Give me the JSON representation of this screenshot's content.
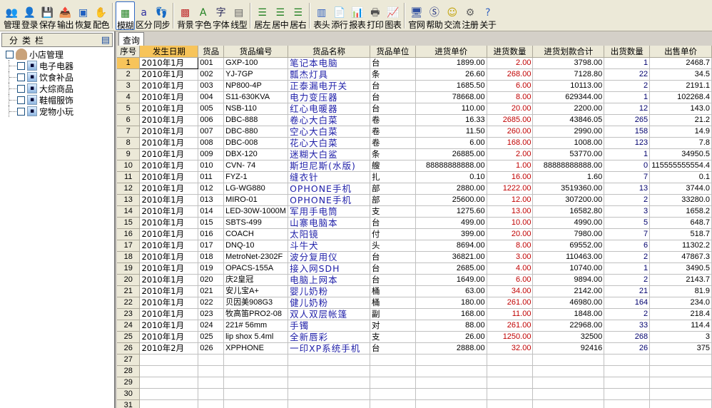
{
  "toolbar": {
    "groups": [
      [
        {
          "name": "manage",
          "label": "管理",
          "icon": "people-icon",
          "glyph": "👥",
          "color": "#c04040"
        },
        {
          "name": "login",
          "label": "登录",
          "icon": "user-icon",
          "glyph": "👤",
          "color": "#3050b0"
        },
        {
          "name": "save",
          "label": "保存",
          "icon": "disk-icon",
          "glyph": "💾",
          "color": "#6060a0"
        },
        {
          "name": "export",
          "label": "输出",
          "icon": "export-icon",
          "glyph": "📤",
          "color": "#c03030"
        },
        {
          "name": "restore",
          "label": "恢复",
          "icon": "cube-icon",
          "glyph": "▣",
          "color": "#2060c0"
        },
        {
          "name": "colors",
          "label": "配色",
          "icon": "hand-icon",
          "glyph": "✋",
          "color": "#c04040"
        }
      ],
      [
        {
          "name": "fuzzy",
          "label": "模糊",
          "icon": "grid-fuzzy-icon",
          "glyph": "▦",
          "color": "#208020",
          "active": true
        },
        {
          "name": "distinguish",
          "label": "区分",
          "icon": "text-a-icon",
          "glyph": "a",
          "color": "#3030a0"
        },
        {
          "name": "sync",
          "label": "同步",
          "icon": "footprint-icon",
          "glyph": "👣",
          "color": "#a0a0a0"
        }
      ],
      [
        {
          "name": "background",
          "label": "背景",
          "icon": "palette-grid-icon",
          "glyph": "▩",
          "color": "#c03030"
        },
        {
          "name": "font-color",
          "label": "字色",
          "icon": "font-color-icon",
          "glyph": "A",
          "color": "#208020"
        },
        {
          "name": "font",
          "label": "字体",
          "icon": "font-icon",
          "glyph": "字",
          "color": "#303060"
        },
        {
          "name": "gridlines",
          "label": "线型",
          "icon": "gridline-icon",
          "glyph": "▤",
          "color": "#606060"
        }
      ],
      [
        {
          "name": "align-left",
          "label": "居左",
          "icon": "align-left-icon",
          "glyph": "☰",
          "color": "#208020"
        },
        {
          "name": "align-center",
          "label": "居中",
          "icon": "align-center-icon",
          "glyph": "☰",
          "color": "#208020"
        },
        {
          "name": "align-right",
          "label": "居右",
          "icon": "align-right-icon",
          "glyph": "☰",
          "color": "#208020"
        }
      ],
      [
        {
          "name": "header",
          "label": "表头",
          "icon": "table-header-icon",
          "glyph": "▥",
          "color": "#3060c0"
        },
        {
          "name": "add-row",
          "label": "添行",
          "icon": "add-row-icon",
          "glyph": "📄",
          "color": "#3060c0"
        },
        {
          "name": "report",
          "label": "报表",
          "icon": "report-icon",
          "glyph": "📊",
          "color": "#3050a0"
        },
        {
          "name": "print",
          "label": "打印",
          "icon": "printer-icon",
          "glyph": "🖶",
          "color": "#505050"
        },
        {
          "name": "chart",
          "label": "图表",
          "icon": "chart-icon",
          "glyph": "📈",
          "color": "#c03030"
        }
      ],
      [
        {
          "name": "website",
          "label": "官网",
          "icon": "monitor-icon",
          "glyph": "🖥",
          "color": "#3050a0"
        },
        {
          "name": "help",
          "label": "帮助",
          "icon": "help-s-icon",
          "glyph": "Ⓢ",
          "color": "#203080"
        },
        {
          "name": "chat",
          "label": "交流",
          "icon": "smiley-icon",
          "glyph": "☺",
          "color": "#c0a000"
        },
        {
          "name": "register",
          "label": "注册",
          "icon": "register-icon",
          "glyph": "⚙",
          "color": "#606060"
        },
        {
          "name": "about",
          "label": "关于",
          "icon": "question-icon",
          "glyph": "?",
          "color": "#3060c0"
        }
      ]
    ]
  },
  "sidebar": {
    "title": "分类栏",
    "root": "小店管理",
    "items": [
      "电子电器",
      "饮食补品",
      "大综商品",
      "鞋帽服饰",
      "宠物小玩"
    ]
  },
  "grid": {
    "tab": "查询",
    "columns": [
      "序号",
      "发生日期",
      "货品",
      "货品编号",
      "货品名称",
      "货品单位",
      "进货单价",
      "进货数量",
      "进货划款合计",
      "出货数量",
      "出售单价"
    ],
    "rows": [
      [
        "1",
        "2010年1月",
        "001",
        "GXP-100",
        "笔记本电脑",
        "台",
        "1899.00",
        "2.00",
        "3798.00",
        "1",
        "2468.7"
      ],
      [
        "2",
        "2010年1月",
        "002",
        "YJ-7GP",
        "瓢杰灯具",
        "条",
        "26.60",
        "268.00",
        "7128.80",
        "22",
        "34.5"
      ],
      [
        "3",
        "2010年1月",
        "003",
        "NP800-4P",
        "正泰漏电开关",
        "台",
        "1685.50",
        "6.00",
        "10113.00",
        "2",
        "2191.1"
      ],
      [
        "4",
        "2010年1月",
        "004",
        "S11-630KVA",
        "电力变压器",
        "台",
        "78668.00",
        "8.00",
        "629344.00",
        "1",
        "102268.4"
      ],
      [
        "5",
        "2010年1月",
        "005",
        "NSB-110",
        "红心电暖器",
        "台",
        "110.00",
        "20.00",
        "2200.00",
        "12",
        "143.0"
      ],
      [
        "6",
        "2010年1月",
        "006",
        "DBC-888",
        "卷心大白菜",
        "卷",
        "16.33",
        "2685.00",
        "43846.05",
        "265",
        "21.2"
      ],
      [
        "7",
        "2010年1月",
        "007",
        "DBC-880",
        "空心大白菜",
        "卷",
        "11.50",
        "260.00",
        "2990.00",
        "158",
        "14.9"
      ],
      [
        "8",
        "2010年1月",
        "008",
        "DBC-008",
        "花心大白菜",
        "卷",
        "6.00",
        "168.00",
        "1008.00",
        "123",
        "7.8"
      ],
      [
        "9",
        "2010年1月",
        "009",
        "DBX-120",
        "迷糊大白鲨",
        "条",
        "26885.00",
        "2.00",
        "53770.00",
        "1",
        "34950.5"
      ],
      [
        "10",
        "2010年1月",
        "010",
        "CVN- 74",
        "斯坦尼斯(水版)",
        "艘",
        "88888888888.00",
        "1.00",
        "88888888888.00",
        "0",
        "115555555554.4"
      ],
      [
        "11",
        "2010年1月",
        "011",
        "FYZ-1",
        "缝衣针",
        "扎",
        "0.10",
        "16.00",
        "1.60",
        "7",
        "0.1"
      ],
      [
        "12",
        "2010年1月",
        "012",
        "LG-WG880",
        "OPHONE手机",
        "部",
        "2880.00",
        "1222.00",
        "3519360.00",
        "13",
        "3744.0"
      ],
      [
        "13",
        "2010年1月",
        "013",
        "MIRO-01",
        "OPHONE手机",
        "部",
        "25600.00",
        "12.00",
        "307200.00",
        "2",
        "33280.0"
      ],
      [
        "14",
        "2010年1月",
        "014",
        "LED-30W-1000M",
        "军用手电筒",
        "支",
        "1275.60",
        "13.00",
        "16582.80",
        "3",
        "1658.2"
      ],
      [
        "15",
        "2010年1月",
        "015",
        "SBTS-499",
        "山寨电脑本",
        "台",
        "499.00",
        "10.00",
        "4990.00",
        "5",
        "648.7"
      ],
      [
        "16",
        "2010年1月",
        "016",
        "COACH",
        "太阳镜",
        "付",
        "399.00",
        "20.00",
        "7980.00",
        "7",
        "518.7"
      ],
      [
        "17",
        "2010年1月",
        "017",
        "DNQ-10",
        "斗牛犬",
        "头",
        "8694.00",
        "8.00",
        "69552.00",
        "6",
        "11302.2"
      ],
      [
        "18",
        "2010年1月",
        "018",
        "MetroNet-2302F",
        "波分复用仪",
        "台",
        "36821.00",
        "3.00",
        "110463.00",
        "2",
        "47867.3"
      ],
      [
        "19",
        "2010年1月",
        "019",
        "OPACS-155A",
        "接入网SDH",
        "台",
        "2685.00",
        "4.00",
        "10740.00",
        "1",
        "3490.5"
      ],
      [
        "20",
        "2010年1月",
        "020",
        "庆2皇冠",
        "电脑上网本",
        "台",
        "1649.00",
        "6.00",
        "9894.00",
        "2",
        "2143.7"
      ],
      [
        "21",
        "2010年1月",
        "021",
        "安儿宝A+",
        "婴儿奶粉",
        "桶",
        "63.00",
        "34.00",
        "2142.00",
        "21",
        "81.9"
      ],
      [
        "22",
        "2010年1月",
        "022",
        "贝因美908G3",
        "健儿奶粉",
        "桶",
        "180.00",
        "261.00",
        "46980.00",
        "164",
        "234.0"
      ],
      [
        "23",
        "2010年1月",
        "023",
        "牧高笛PRO2-08",
        "双人双层帐篷",
        "副",
        "168.00",
        "11.00",
        "1848.00",
        "2",
        "218.4"
      ],
      [
        "24",
        "2010年1月",
        "024",
        "221# 56mm",
        "手镯",
        "对",
        "88.00",
        "261.00",
        "22968.00",
        "33",
        "114.4"
      ],
      [
        "25",
        "2010年1月",
        "025",
        "lip shox 5.4ml",
        "全新唇彩",
        "支",
        "26.00",
        "1250.00",
        "32500",
        "268",
        "3"
      ],
      [
        "26",
        "2010年2月",
        "026",
        "XPPHONE",
        "一印XP系统手机",
        "台",
        "2888.00",
        "32.00",
        "92416",
        "26",
        "375"
      ],
      [
        "27",
        "",
        "",
        "",
        "",
        "",
        "",
        "",
        "",
        "",
        ""
      ],
      [
        "28",
        "",
        "",
        "",
        "",
        "",
        "",
        "",
        "",
        "",
        ""
      ],
      [
        "29",
        "",
        "",
        "",
        "",
        "",
        "",
        "",
        "",
        "",
        ""
      ],
      [
        "30",
        "",
        "",
        "",
        "",
        "",
        "",
        "",
        "",
        "",
        ""
      ],
      [
        "31",
        "",
        "",
        "",
        "",
        "",
        "",
        "",
        "",
        "",
        ""
      ],
      [
        "32",
        "",
        "",
        "",
        "",
        "",
        "",
        "",
        "",
        "",
        ""
      ]
    ],
    "selected_row": 1,
    "highlight_column": 1
  },
  "colors": {
    "name_text": "#1f1fa8",
    "qty_text": "#c00000",
    "out_qty_text": "#00006e",
    "selection": "#f7c45a"
  }
}
